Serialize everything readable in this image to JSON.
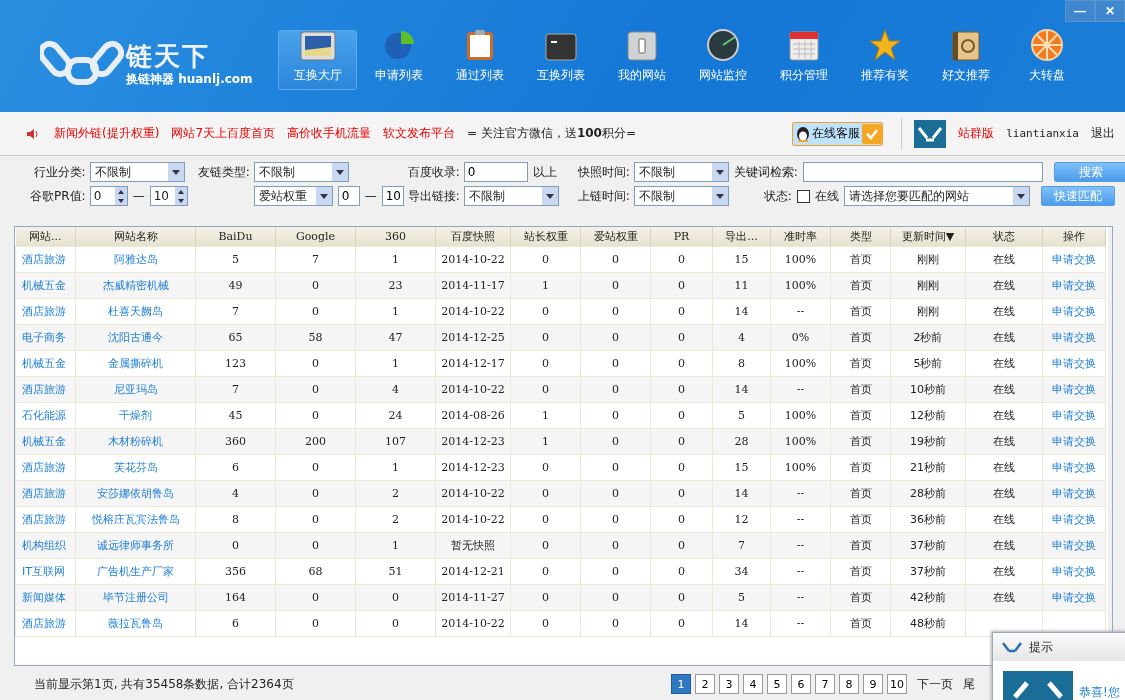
{
  "window": {
    "controls": [
      "—",
      "✕"
    ]
  },
  "brand": {
    "name": "链天下",
    "tagline": "换链神器 huanlj.com"
  },
  "nav": [
    {
      "label": "互换大厅",
      "selected": true
    },
    {
      "label": "申请列表",
      "selected": false
    },
    {
      "label": "通过列表",
      "selected": false
    },
    {
      "label": "互换列表",
      "selected": false
    },
    {
      "label": "我的网站",
      "selected": false
    },
    {
      "label": "网站监控",
      "selected": false
    },
    {
      "label": "积分管理",
      "selected": false
    },
    {
      "label": "推荐有奖",
      "selected": false
    },
    {
      "label": "好文推荐",
      "selected": false
    },
    {
      "label": "大转盘",
      "selected": false
    }
  ],
  "notice": {
    "links": [
      "新闻外链(提升权重)",
      "网站7天上百度首页",
      "高价收手机流量",
      "软文发布平台"
    ],
    "message": "= 关注官方微信，送**100**积分=",
    "support": "在线客服",
    "edition": "站群版",
    "username": "liantianxia",
    "logout": "退出"
  },
  "filters": {
    "industry": {
      "label": "行业分类:",
      "value": "不限制"
    },
    "link_type": {
      "label": "友链类型:",
      "value": "不限制"
    },
    "baidu_index": {
      "label": "百度收录:",
      "value": "0",
      "suffix": "以上"
    },
    "snapshot_time": {
      "label": "快照时间:",
      "value": "不限制"
    },
    "keyword": {
      "label": "关键词检索:"
    },
    "search_button": "搜索",
    "pr": {
      "label": "谷歌PR值:",
      "from": "0",
      "dash": "—",
      "to": "10"
    },
    "weight": {
      "value": "爱站权重",
      "from": "0",
      "dash": "—",
      "to": "10"
    },
    "outbound": {
      "label": "导出链接:",
      "value": "不限制"
    },
    "link_time": {
      "label": "上链时间:",
      "value": "不限制"
    },
    "status": {
      "label": "状态:",
      "option": "在线",
      "checked": false
    },
    "match_site": {
      "value": "请选择您要匹配的网站"
    },
    "match_button": "快速匹配"
  },
  "table": {
    "columns": [
      "网站...",
      "网站名称",
      "BaiDu",
      "Google",
      "360",
      "百度快照",
      "站长权重",
      "爱站权重",
      "PR",
      "导出...",
      "准时率",
      "类型",
      "更新时间▼",
      "状态",
      "操作"
    ],
    "rows": [
      [
        "酒店旅游",
        "阿雅达岛",
        "5",
        "7",
        "1",
        "2014-10-22",
        "0",
        "0",
        "0",
        "15",
        "100%",
        "首页",
        "刚刚",
        "在线",
        "申请交换"
      ],
      [
        "机械五金",
        "杰威精密机械",
        "49",
        "0",
        "23",
        "2014-11-17",
        "1",
        "0",
        "0",
        "11",
        "100%",
        "首页",
        "刚刚",
        "在线",
        "申请交换"
      ],
      [
        "酒店旅游",
        "杜喜天阙岛",
        "7",
        "0",
        "1",
        "2014-10-22",
        "0",
        "0",
        "0",
        "14",
        "--",
        "首页",
        "刚刚",
        "在线",
        "申请交换"
      ],
      [
        "电子商务",
        "沈阳古通今",
        "65",
        "58",
        "47",
        "2014-12-25",
        "0",
        "0",
        "0",
        "4",
        "0%",
        "首页",
        "2秒前",
        "在线",
        "申请交换"
      ],
      [
        "机械五金",
        "金属撕碎机",
        "123",
        "0",
        "1",
        "2014-12-17",
        "0",
        "0",
        "0",
        "8",
        "100%",
        "首页",
        "5秒前",
        "在线",
        "申请交换"
      ],
      [
        "酒店旅游",
        "尼亚玛岛",
        "7",
        "0",
        "4",
        "2014-10-22",
        "0",
        "0",
        "0",
        "14",
        "--",
        "首页",
        "10秒前",
        "在线",
        "申请交换"
      ],
      [
        "石化能源",
        "干燥剂",
        "45",
        "0",
        "24",
        "2014-08-26",
        "1",
        "0",
        "0",
        "5",
        "100%",
        "首页",
        "12秒前",
        "在线",
        "申请交换"
      ],
      [
        "机械五金",
        "木材粉碎机",
        "360",
        "200",
        "107",
        "2014-12-23",
        "1",
        "0",
        "0",
        "28",
        "100%",
        "首页",
        "19秒前",
        "在线",
        "申请交换"
      ],
      [
        "酒店旅游",
        "芙花芬岛",
        "6",
        "0",
        "1",
        "2014-12-23",
        "0",
        "0",
        "0",
        "15",
        "100%",
        "首页",
        "21秒前",
        "在线",
        "申请交换"
      ],
      [
        "酒店旅游",
        "安莎娜依胡鲁岛",
        "4",
        "0",
        "2",
        "2014-10-22",
        "0",
        "0",
        "0",
        "14",
        "--",
        "首页",
        "28秒前",
        "在线",
        "申请交换"
      ],
      [
        "酒店旅游",
        "悦榕庄瓦宾法鲁岛",
        "8",
        "0",
        "2",
        "2014-10-22",
        "0",
        "0",
        "0",
        "12",
        "--",
        "首页",
        "36秒前",
        "在线",
        "申请交换"
      ],
      [
        "机构组织",
        "诚远律师事务所",
        "0",
        "0",
        "1",
        "暂无快照",
        "0",
        "0",
        "0",
        "7",
        "--",
        "首页",
        "37秒前",
        "在线",
        "申请交换"
      ],
      [
        "IT互联网",
        "广告机生产厂家",
        "356",
        "68",
        "51",
        "2014-12-21",
        "0",
        "0",
        "0",
        "34",
        "--",
        "首页",
        "37秒前",
        "在线",
        "申请交换"
      ],
      [
        "新闻媒体",
        "毕节注册公司",
        "164",
        "0",
        "0",
        "2014-11-27",
        "0",
        "0",
        "0",
        "5",
        "--",
        "首页",
        "42秒前",
        "在线",
        "申请交换"
      ],
      [
        "酒店旅游",
        "薇拉瓦鲁岛",
        "6",
        "0",
        "0",
        "2014-10-22",
        "0",
        "0",
        "0",
        "14",
        "--",
        "首页",
        "48秒前"
      ]
    ]
  },
  "footer": {
    "summary": "当前显示第1页, 共有35458条数据, 合计2364页",
    "pages": [
      {
        "label": "1",
        "selected": true
      },
      {
        "label": "2",
        "selected": false
      },
      {
        "label": "3",
        "selected": false
      },
      {
        "label": "4",
        "selected": false
      },
      {
        "label": "5",
        "selected": false
      },
      {
        "label": "6",
        "selected": false
      },
      {
        "label": "7",
        "selected": false
      },
      {
        "label": "8",
        "selected": false
      },
      {
        "label": "9",
        "selected": false
      },
      {
        "label": "10",
        "selected": false
      }
    ],
    "next": "下一页",
    "last": "尾"
  },
  "popup": {
    "title": "提示",
    "message": "恭喜!您"
  }
}
